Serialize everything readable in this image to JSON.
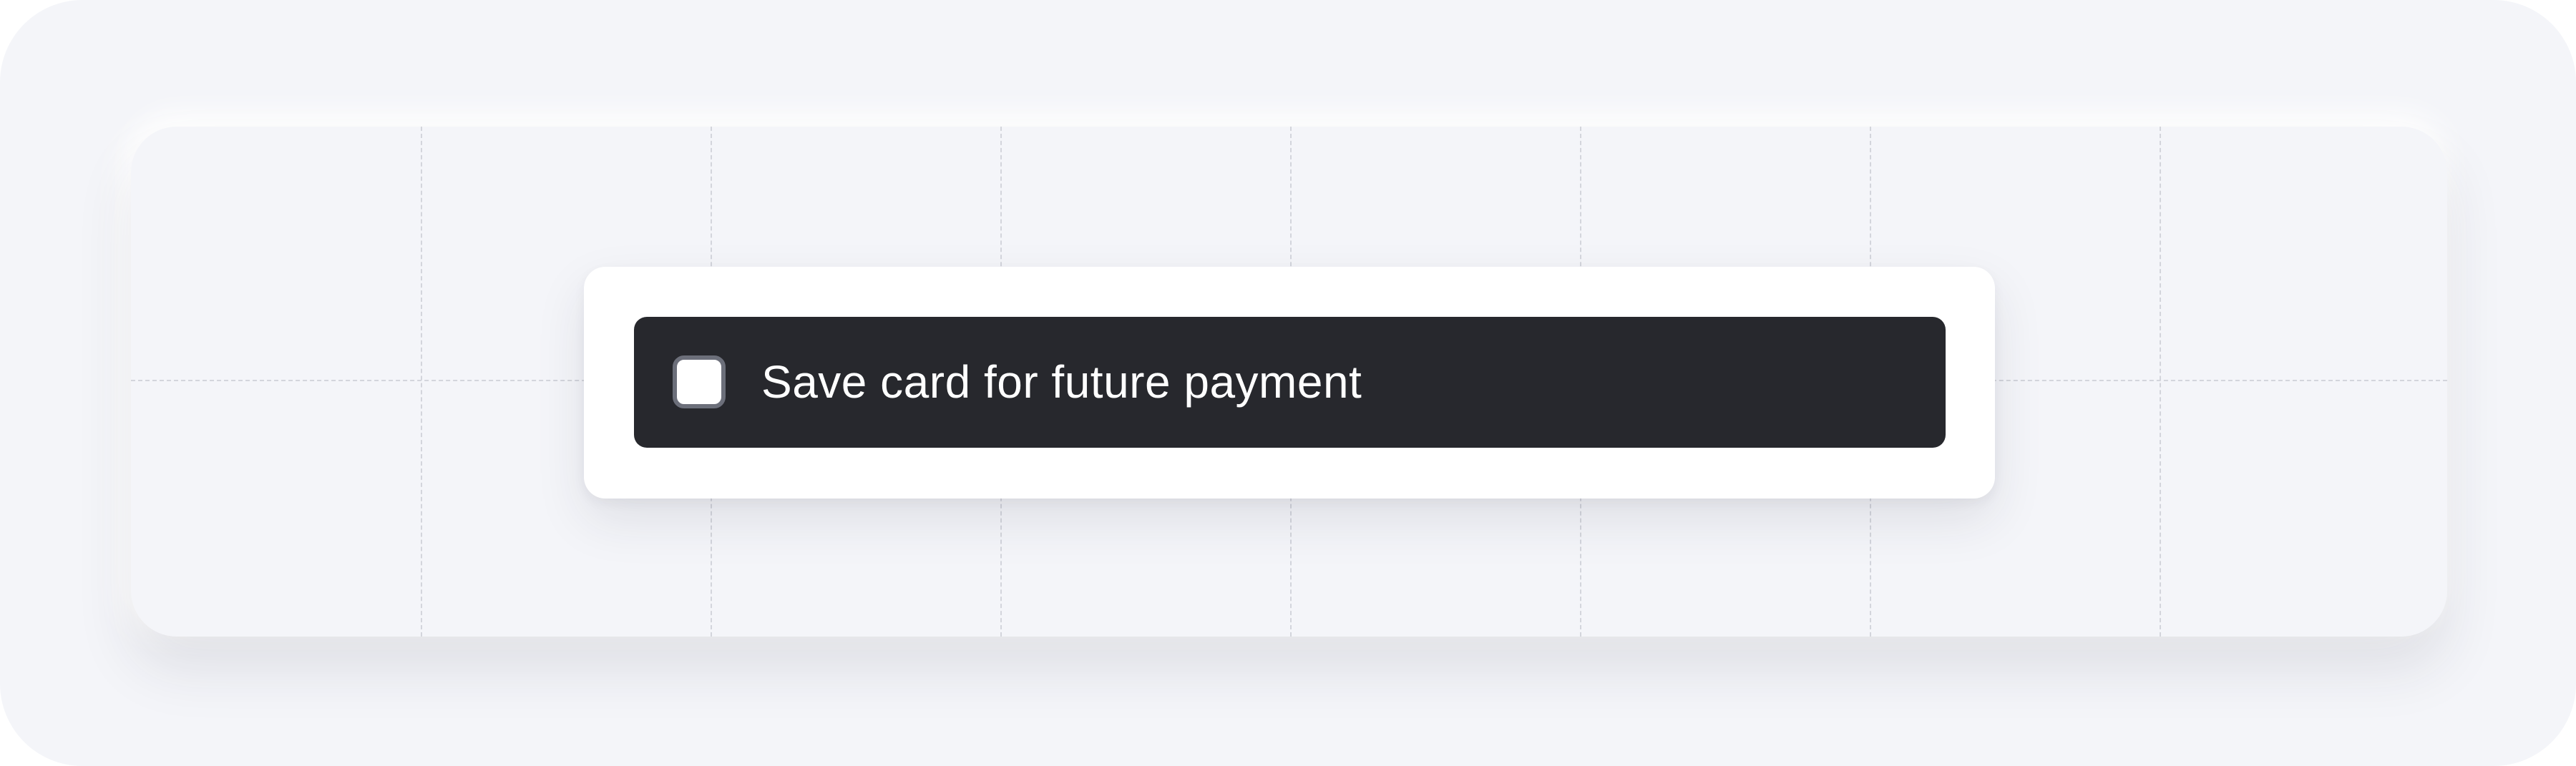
{
  "save_card_option": {
    "label": "Save card for future payment",
    "checked": false
  },
  "colors": {
    "page_background": "#f4f5f9",
    "card_background": "#ffffff",
    "option_background": "#27282d",
    "label_text": "#ffffff",
    "checkbox_border": "#6c6f7a",
    "grid_line": "#d3d5dc"
  }
}
